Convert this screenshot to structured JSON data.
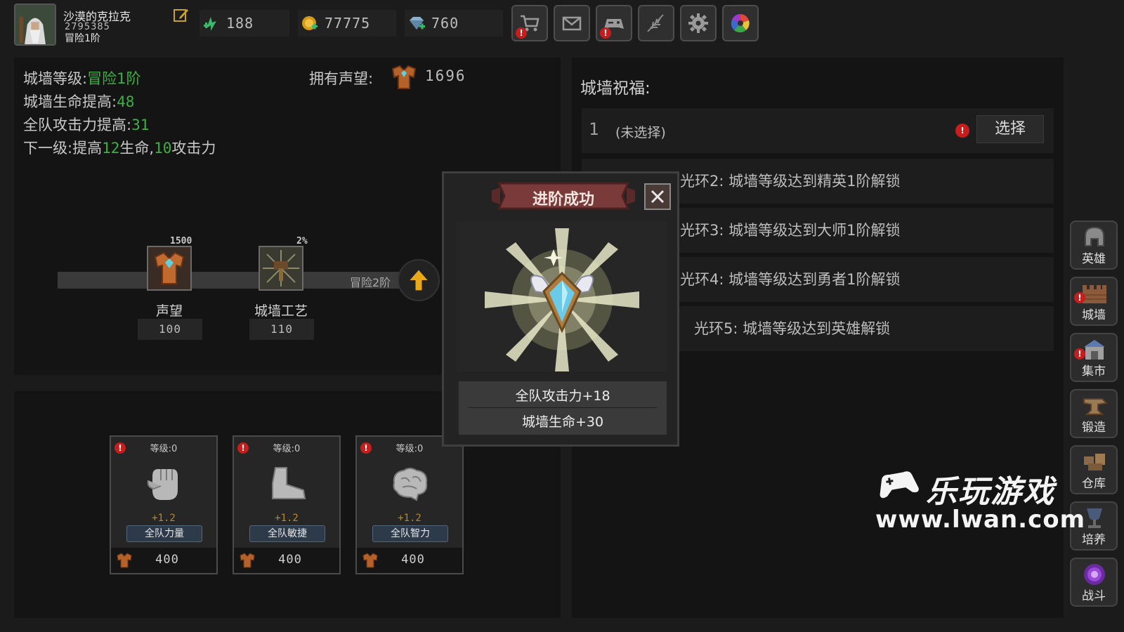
{
  "player": {
    "name": "沙漠的克拉克",
    "id": "2795385",
    "rank": "冒险1阶"
  },
  "resources": [
    {
      "icon": "energy-icon",
      "value": "188"
    },
    {
      "icon": "coin-icon",
      "value": "77775"
    },
    {
      "icon": "diamond-icon",
      "value": "760"
    }
  ],
  "top_buttons": [
    "shop-icon",
    "mail-icon",
    "gamepad-icon",
    "feather-icon",
    "settings-icon",
    "color-wheel-icon"
  ],
  "wall": {
    "level_label": "城墙等级:",
    "level_value": "冒险1阶",
    "hp_label": "城墙生命提高:",
    "hp_value": "48",
    "atk_label": "全队攻击力提高:",
    "atk_value": "31",
    "next_prefix": "下一级:提高",
    "next_hp": "12",
    "next_hp_unit": "生命,",
    "next_atk": "10",
    "next_atk_unit": "攻击力",
    "prestige_label": "拥有声望:",
    "prestige_value": "1696",
    "track_label": "冒险2阶"
  },
  "nodes": [
    {
      "top": "1500",
      "label": "声望",
      "value": "100"
    },
    {
      "top": "2%",
      "label": "城墙工艺",
      "value": "110"
    }
  ],
  "cards": [
    {
      "level": "等级:0",
      "plus": "+1.2",
      "ribbon": "全队力量",
      "cost": "400",
      "icon": "fist-icon"
    },
    {
      "level": "等级:0",
      "plus": "+1.2",
      "ribbon": "全队敏捷",
      "cost": "400",
      "icon": "boot-icon"
    },
    {
      "level": "等级:0",
      "plus": "+1.2",
      "ribbon": "全队智力",
      "cost": "400",
      "icon": "brain-icon"
    }
  ],
  "blessing": {
    "title": "城墙祝福:",
    "slot_number": "1",
    "slot_text": "(未选择)",
    "select_label": "选择",
    "halos": [
      "光环2:  城墙等级达到精英1阶解锁",
      "光环3:  城墙等级达到大师1阶解锁",
      "光环4:  城墙等级达到勇者1阶解锁",
      "光环5:  城墙等级达到英雄解锁"
    ]
  },
  "sidebar": [
    {
      "label": "英雄",
      "icon": "helmet-icon",
      "alert": false
    },
    {
      "label": "城墙",
      "icon": "wall-icon",
      "alert": true
    },
    {
      "label": "集市",
      "icon": "market-icon",
      "alert": true
    },
    {
      "label": "锻造",
      "icon": "anvil-icon",
      "alert": false
    },
    {
      "label": "仓库",
      "icon": "warehouse-icon",
      "alert": false
    },
    {
      "label": "培养",
      "icon": "chalice-icon",
      "alert": false
    },
    {
      "label": "战斗",
      "icon": "portal-icon",
      "alert": false
    }
  ],
  "modal": {
    "title": "进阶成功",
    "stat1": "全队攻击力+18",
    "stat2": "城墙生命+30"
  },
  "watermark": {
    "title": "乐玩游戏",
    "url": "www.lwan.com"
  },
  "colors": {
    "accent_green": "#3cb044",
    "alert_red": "#c81d1d",
    "bonus_gold": "#b48a2a"
  }
}
